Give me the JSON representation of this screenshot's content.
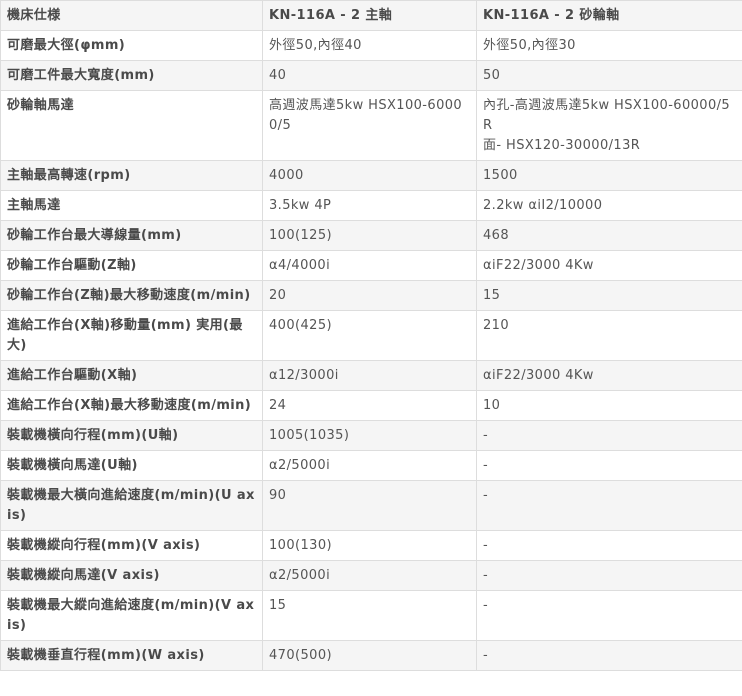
{
  "table": {
    "header": [
      "機床仕様",
      "KN-116A - 2 主軸",
      "KN-116A - 2 砂輪軸"
    ],
    "rows": [
      [
        "可磨最大徑(φmm)",
        "外徑50,內徑40",
        "外徑50,內徑30"
      ],
      [
        "可磨工件最大寬度(mm)",
        "40",
        "50"
      ],
      [
        "砂輪軸馬達",
        "高週波馬達5kw HSX100-60000/5",
        "內孔-高週波馬達5kw HSX100-60000/5R\n面- HSX120-30000/13R"
      ],
      [
        "主軸最高轉速(rpm)",
        "4000",
        "1500"
      ],
      [
        "主軸馬達",
        "3.5kw 4P",
        "2.2kw αiI2/10000"
      ],
      [
        "砂輪工作台最大導線量(mm)",
        "100(125)",
        "468"
      ],
      [
        "砂輪工作台驅動(Z軸)",
        "α4/4000i",
        "αiF22/3000 4Kw"
      ],
      [
        "砂輪工作台(Z軸)最大移動速度(m/min)",
        "20",
        "15"
      ],
      [
        "進給工作台(X軸)移動量(mm) 実用(最大)",
        "400(425)",
        "210"
      ],
      [
        "進給工作台驅動(X軸)",
        "α12/3000i",
        "αiF22/3000 4Kw"
      ],
      [
        "進給工作台(X軸)最大移動速度(m/min)",
        "24",
        "10"
      ],
      [
        "裝載機橫向行程(mm)(U軸)",
        "1005(1035)",
        "-"
      ],
      [
        "裝載機橫向馬達(U軸)",
        "α2/5000i",
        "-"
      ],
      [
        "裝載機最大橫向進給速度(m/min)(U axis)",
        "90",
        "-"
      ],
      [
        "裝載機縱向行程(mm)(V axis)",
        "100(130)",
        "-"
      ],
      [
        "裝載機縱向馬達(V axis)",
        "α2/5000i",
        "-"
      ],
      [
        "裝載機最大縱向進給速度(m/min)(V axis)",
        "15",
        "-"
      ],
      [
        "裝載機垂直行程(mm)(W axis)",
        "470(500)",
        "-"
      ]
    ]
  }
}
